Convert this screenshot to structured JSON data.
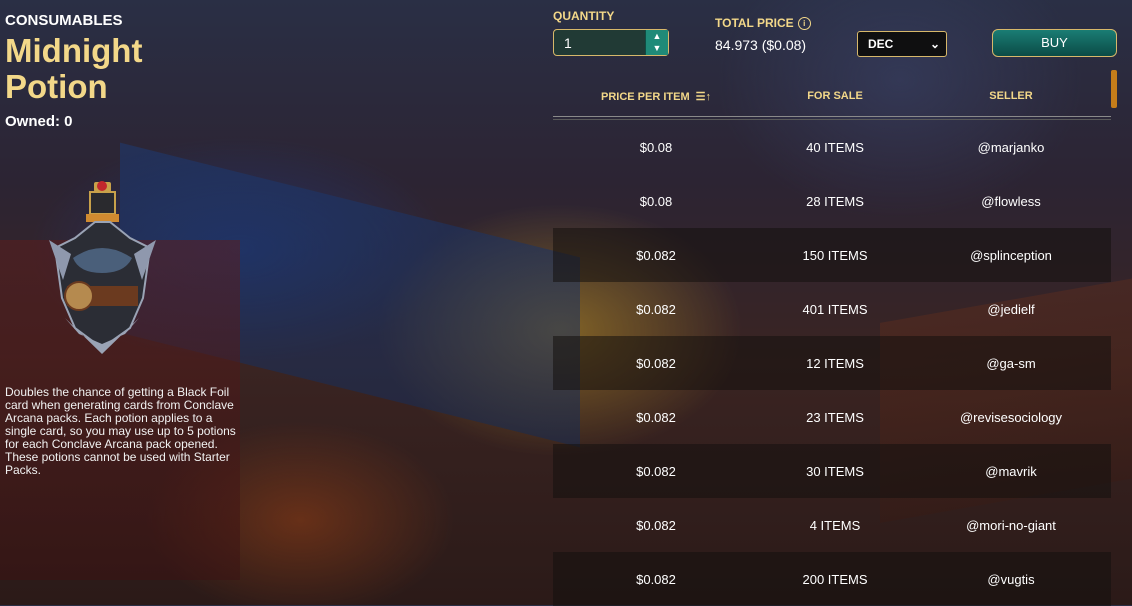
{
  "item": {
    "category": "CONSUMABLES",
    "name_line1": "Midnight",
    "name_line2": "Potion",
    "owned": "Owned: 0",
    "description": "Doubles the chance of getting a Black Foil card when generating cards from Conclave Arcana packs. Each potion applies to a single card, so you may use up to 5 potions for each Conclave Arcana pack opened. These potions cannot be used with Starter Packs."
  },
  "purchase": {
    "quantity_label": "QUANTITY",
    "quantity_value": "1",
    "total_label": "TOTAL PRICE",
    "total_value": "84.973 ($0.08)",
    "currency": "DEC",
    "buy_label": "BUY",
    "info_icon": "i"
  },
  "table": {
    "headers": [
      "PRICE PER ITEM",
      "FOR SALE",
      "SELLER"
    ],
    "rows": [
      {
        "price": "$0.08",
        "for_sale": "40 ITEMS",
        "seller": "@marjanko"
      },
      {
        "price": "$0.08",
        "for_sale": "28 ITEMS",
        "seller": "@flowless"
      },
      {
        "price": "$0.082",
        "for_sale": "150 ITEMS",
        "seller": "@splinception"
      },
      {
        "price": "$0.082",
        "for_sale": "401 ITEMS",
        "seller": "@jedielf"
      },
      {
        "price": "$0.082",
        "for_sale": "12 ITEMS",
        "seller": "@ga-sm"
      },
      {
        "price": "$0.082",
        "for_sale": "23 ITEMS",
        "seller": "@revisesociology"
      },
      {
        "price": "$0.082",
        "for_sale": "30 ITEMS",
        "seller": "@mavrik"
      },
      {
        "price": "$0.082",
        "for_sale": "4 ITEMS",
        "seller": "@mori-no-giant"
      },
      {
        "price": "$0.082",
        "for_sale": "200 ITEMS",
        "seller": "@vugtis"
      }
    ]
  },
  "colors": {
    "gold": "#f3d889",
    "teal": "#1a7d74",
    "scroll": "#c57d1a"
  }
}
